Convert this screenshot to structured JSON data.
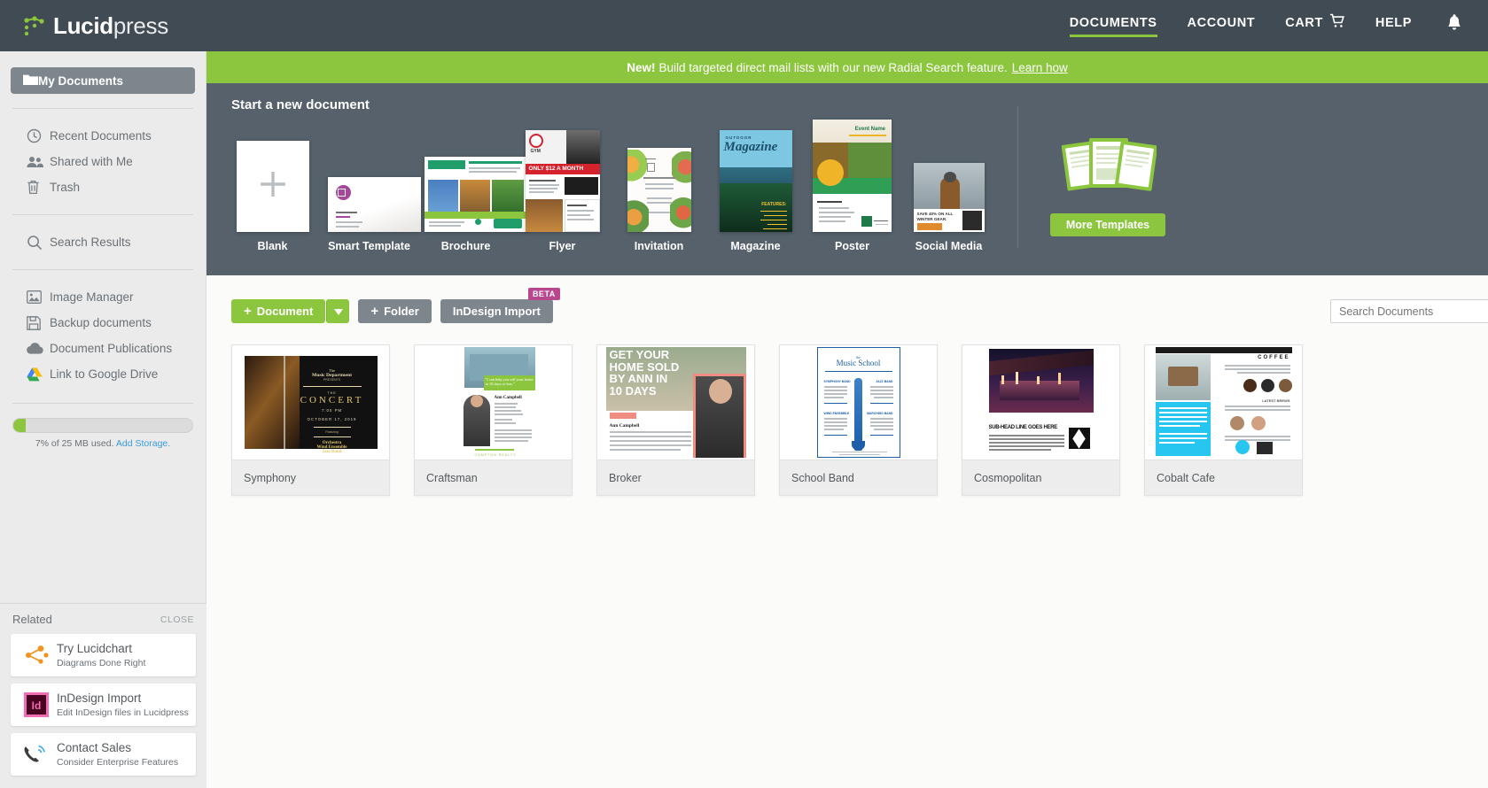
{
  "brand": {
    "name_bold": "Lucid",
    "name_light": "press",
    "logo_icon": "lucidpress-logo-icon",
    "accent_green": "#8cc63e",
    "dark": "#404b54",
    "hero_bg": "#56616b"
  },
  "topnav": {
    "items": [
      {
        "label": "DOCUMENTS",
        "active": true,
        "icon": ""
      },
      {
        "label": "ACCOUNT",
        "active": false,
        "icon": ""
      },
      {
        "label": "CART",
        "active": false,
        "icon": "cart-icon"
      },
      {
        "label": "HELP",
        "active": false,
        "icon": ""
      }
    ],
    "notification_icon": "bell-icon"
  },
  "promo": {
    "bold": "New!",
    "text": "Build targeted direct mail lists with our new Radial Search feature.",
    "link": "Learn how"
  },
  "sidebar": {
    "primary": {
      "label": "My Documents",
      "icon": "folder-icon"
    },
    "group1": [
      {
        "label": "Recent Documents",
        "icon": "clock-icon"
      },
      {
        "label": "Shared with Me",
        "icon": "people-icon"
      },
      {
        "label": "Trash",
        "icon": "trash-icon"
      }
    ],
    "group2": [
      {
        "label": "Search Results",
        "icon": "search-icon"
      }
    ],
    "group3": [
      {
        "label": "Image Manager",
        "icon": "image-icon"
      },
      {
        "label": "Backup documents",
        "icon": "floppy-icon"
      },
      {
        "label": "Document Publications",
        "icon": "cloud-icon"
      },
      {
        "label": "Link to Google Drive",
        "icon": "google-drive-icon"
      }
    ],
    "storage": {
      "percent": 7,
      "text": "7% of 25 MB used.",
      "link": "Add Storage."
    }
  },
  "related": {
    "title": "Related",
    "close": "CLOSE",
    "cards": [
      {
        "title": "Try Lucidchart",
        "sub": "Diagrams Done Right",
        "icon": "lucidchart-icon"
      },
      {
        "title": "InDesign Import",
        "sub": "Edit InDesign files in Lucidpress",
        "icon": "indesign-icon"
      },
      {
        "title": "Contact Sales",
        "sub": "Consider Enterprise Features",
        "icon": "phone-icon"
      }
    ]
  },
  "hero": {
    "title": "Start a new document",
    "templates": [
      {
        "label": "Blank",
        "kind": "blank"
      },
      {
        "label": "Smart Template",
        "kind": "smart"
      },
      {
        "label": "Brochure",
        "kind": "brochure"
      },
      {
        "label": "Flyer",
        "kind": "flyer"
      },
      {
        "label": "Invitation",
        "kind": "invitation"
      },
      {
        "label": "Magazine",
        "kind": "magazine"
      },
      {
        "label": "Poster",
        "kind": "poster"
      },
      {
        "label": "Social Media",
        "kind": "social"
      }
    ],
    "more_templates": {
      "label": "More Templates",
      "icon": "templates-stack-icon"
    }
  },
  "toolbar": {
    "document_label": "Document",
    "document_caret_icon": "chevron-down-icon",
    "folder_label": "Folder",
    "indesign_label": "InDesign Import",
    "indesign_badge": "BETA",
    "search_placeholder": "Search Documents"
  },
  "documents": [
    {
      "name": "Symphony",
      "kind": "concert"
    },
    {
      "name": "Craftsman",
      "kind": "craftsman"
    },
    {
      "name": "Broker",
      "kind": "broker"
    },
    {
      "name": "School Band",
      "kind": "schoolband"
    },
    {
      "name": "Cosmopolitan",
      "kind": "cosmopolitan"
    },
    {
      "name": "Cobalt Cafe",
      "kind": "cobaltcafe"
    }
  ]
}
